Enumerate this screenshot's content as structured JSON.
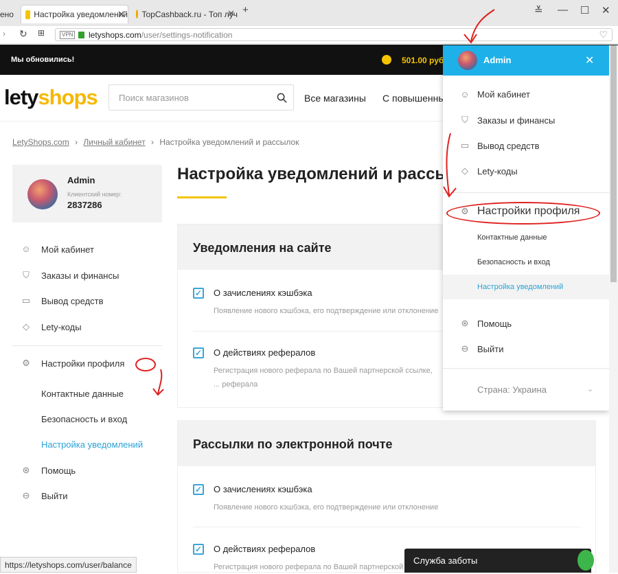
{
  "browser": {
    "tabs": [
      {
        "label": "ено"
      },
      {
        "label": "Настройка уведомлений"
      },
      {
        "label": "TopCashback.ru - Топ луч"
      }
    ],
    "new_tab": "+",
    "url_host": "letyshops.com",
    "url_path": "/user/settings-notification",
    "vpn_badge": "VPN"
  },
  "topbar": {
    "announcement": "Мы обновились!",
    "balance": "501.00 руб."
  },
  "header": {
    "logo_part1": "lety",
    "logo_part2": "shops",
    "search_placeholder": "Поиск магазинов",
    "nav": [
      "Все магазины",
      "С повышенны"
    ]
  },
  "breadcrumb": {
    "items": [
      "LetyShops.com",
      "Личный кабинет",
      "Настройка уведомлений и рассылок"
    ],
    "separator": "›"
  },
  "user_card": {
    "name": "Admin",
    "client_label": "Клиентский номер:",
    "client_number": "2837286"
  },
  "sidebar": {
    "items": [
      "Мой кабинет",
      "Заказы и финансы",
      "Вывод средств",
      "Lety-коды"
    ],
    "profile_settings": "Настройки профиля",
    "sub_items": [
      "Контактные данные",
      "Безопасность и вход",
      "Настройка уведомлений"
    ],
    "bottom_items": [
      "Помощь",
      "Выйти"
    ]
  },
  "page": {
    "title": "Настройка уведомлений и рассы",
    "sections": [
      {
        "title": "Уведомления на сайте",
        "options": [
          {
            "title": "О зачислениях кэшбэка",
            "desc": "Появление нового кэшбэка, его подтверждение или отклонение"
          },
          {
            "title": "О действиях рефералов",
            "desc": "Регистрация нового реферала по Вашей партнерской ссылке, ... реферала"
          }
        ]
      },
      {
        "title": "Рассылки по электронной почте",
        "options": [
          {
            "title": "О зачислениях кэшбэка",
            "desc": "Появление нового кэшбэка, его подтверждение или отклонение"
          },
          {
            "title": "О действиях рефералов",
            "desc": "Регистрация нового реферала по Вашей партнерской ссылке"
          }
        ]
      }
    ]
  },
  "dropdown": {
    "user": "Admin",
    "items": [
      "Мой кабинет",
      "Заказы и финансы",
      "Вывод средств",
      "Lety-коды"
    ],
    "profile_settings": "Настройки профиля",
    "sub_items": [
      "Контактные данные",
      "Безопасность и вход",
      "Настройка уведомлений"
    ],
    "bottom_items": [
      "Помощь",
      "Выйти"
    ],
    "country": "Страна: Украина"
  },
  "status_url": "https://letyshops.com/user/balance",
  "care_widget": "Служба заботы",
  "colors": {
    "accent": "#1eb0e8",
    "link_active": "#2aa3d6",
    "yellow": "#f5c400",
    "annotation": "#e0201f"
  }
}
